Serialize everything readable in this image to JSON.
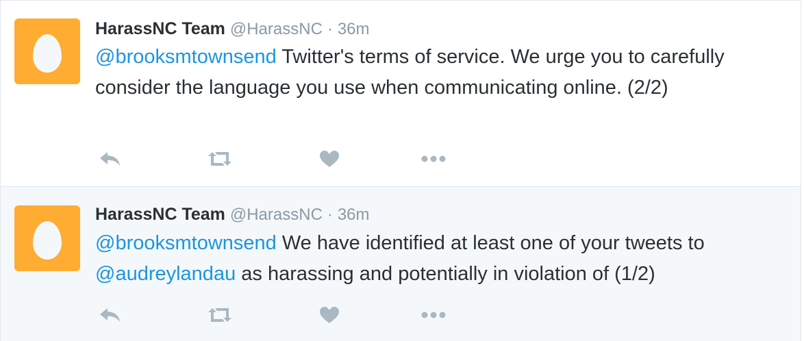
{
  "tweets": [
    {
      "author_name": "HarassNC Team",
      "handle": "@HarassNC",
      "separator": "·",
      "time": "36m",
      "mention": "@brooksmtownsend",
      "text": " Twitter's terms of service. We urge you to carefully consider the language you use when communicating online. (2/2)"
    },
    {
      "author_name": "HarassNC Team",
      "handle": "@HarassNC",
      "separator": "·",
      "time": "36m",
      "mention": "@brooksmtownsend",
      "text_part1": " We have identified at least one of your tweets to ",
      "mention2": "@audreylandau",
      "text_part2": " as harassing and potentially in violation of (1/2)"
    }
  ],
  "colors": {
    "avatar_bg": "#ffac33",
    "mention": "#1b95e0",
    "secondary_text": "#8899a6",
    "icon": "#aab8c2",
    "highlight_bg": "#f5f8fa"
  },
  "icons": [
    "reply-icon",
    "retweet-icon",
    "like-icon",
    "more-icon"
  ]
}
